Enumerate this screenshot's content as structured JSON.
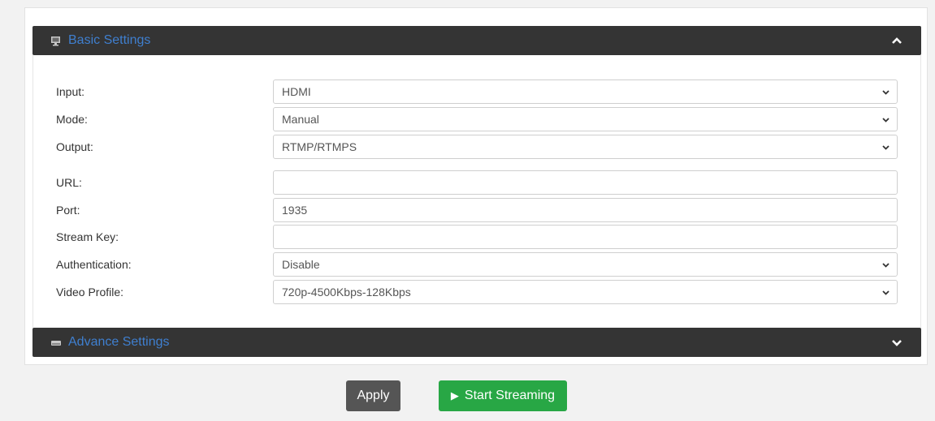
{
  "basic": {
    "title": "Basic Settings",
    "collapse_icon": "chevron-up-icon"
  },
  "advance": {
    "title": "Advance Settings",
    "expand_icon": "chevron-down-icon"
  },
  "form": {
    "input": {
      "label": "Input:",
      "value": "HDMI"
    },
    "mode": {
      "label": "Mode:",
      "value": "Manual"
    },
    "output": {
      "label": "Output:",
      "value": "RTMP/RTMPS"
    },
    "url": {
      "label": "URL:",
      "value": ""
    },
    "port": {
      "label": "Port:",
      "value": "1935"
    },
    "stream_key": {
      "label": "Stream Key:",
      "value": ""
    },
    "authentication": {
      "label": "Authentication:",
      "value": "Disable"
    },
    "video_profile": {
      "label": "Video Profile:",
      "value": "720p-4500Kbps-128Kbps"
    }
  },
  "buttons": {
    "apply": "Apply",
    "start_streaming": "Start Streaming"
  },
  "colors": {
    "header_bg": "#343434",
    "header_title": "#3f7fcf",
    "apply_bg": "#555555",
    "start_bg": "#28a745"
  }
}
